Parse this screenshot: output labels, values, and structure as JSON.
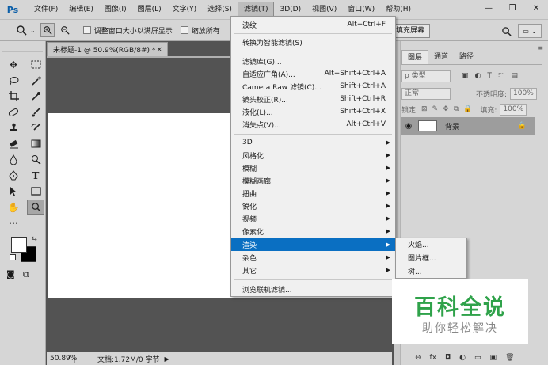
{
  "app": {
    "logo": "Ps"
  },
  "menubar": {
    "items": [
      "文件(F)",
      "编辑(E)",
      "图像(I)",
      "图层(L)",
      "文字(Y)",
      "选择(S)",
      "滤镜(T)",
      "3D(D)",
      "视图(V)",
      "窗口(W)",
      "帮助(H)"
    ],
    "active_index": 6
  },
  "window_controls": {
    "minimize": "—",
    "restore": "❐",
    "close": "✕"
  },
  "options": {
    "checkbox1_label": "调整窗口大小以满屏显示",
    "checkbox2_label": "缩放所有",
    "fill_screen": "填充屏幕"
  },
  "document": {
    "tab_title": "未标题-1 @ 50.9%(RGB/8#) *",
    "tab_close": "×"
  },
  "status": {
    "zoom": "50.89%",
    "doc_info": "文档:1.72M/0 字节",
    "arrow": "▶"
  },
  "layers_panel": {
    "tabs": [
      "图层",
      "通道",
      "路径"
    ],
    "active_tab": 0,
    "kind_label": "ρ 类型",
    "blend_mode": "正常",
    "opacity_label": "不透明度:",
    "opacity_value": "100%",
    "lock_label": "锁定:",
    "fill_label": "填充:",
    "fill_value": "100%",
    "layer_name": "背景",
    "footer_icons": [
      "⊖",
      "fx",
      "◘",
      "◐",
      "▭",
      "▣",
      "🗑"
    ]
  },
  "filter_menu": {
    "items": [
      {
        "label": "波纹",
        "shortcut": "Alt+Ctrl+F"
      },
      {
        "label": "转换为智能滤镜(S)",
        "shortcut": ""
      },
      {
        "label": "滤镜库(G)...",
        "shortcut": ""
      },
      {
        "label": "自适应广角(A)...",
        "shortcut": "Alt+Shift+Ctrl+A"
      },
      {
        "label": "Camera Raw 滤镜(C)...",
        "shortcut": "Shift+Ctrl+A"
      },
      {
        "label": "镜头校正(R)...",
        "shortcut": "Shift+Ctrl+R"
      },
      {
        "label": "液化(L)...",
        "shortcut": "Shift+Ctrl+X"
      },
      {
        "label": "消失点(V)...",
        "shortcut": "Alt+Ctrl+V"
      },
      {
        "label": "3D",
        "submenu": true
      },
      {
        "label": "风格化",
        "submenu": true
      },
      {
        "label": "模糊",
        "submenu": true
      },
      {
        "label": "模糊画廊",
        "submenu": true
      },
      {
        "label": "扭曲",
        "submenu": true
      },
      {
        "label": "锐化",
        "submenu": true
      },
      {
        "label": "视频",
        "submenu": true
      },
      {
        "label": "像素化",
        "submenu": true
      },
      {
        "label": "渲染",
        "submenu": true,
        "highlighted": true
      },
      {
        "label": "杂色",
        "submenu": true
      },
      {
        "label": "其它",
        "submenu": true
      },
      {
        "label": "浏览联机滤镜...",
        "shortcut": ""
      }
    ]
  },
  "render_submenu": {
    "items": [
      "火焰...",
      "图片框...",
      "树..."
    ]
  },
  "watermark": {
    "title": "百科全说",
    "subtitle": "助你轻松解决"
  }
}
